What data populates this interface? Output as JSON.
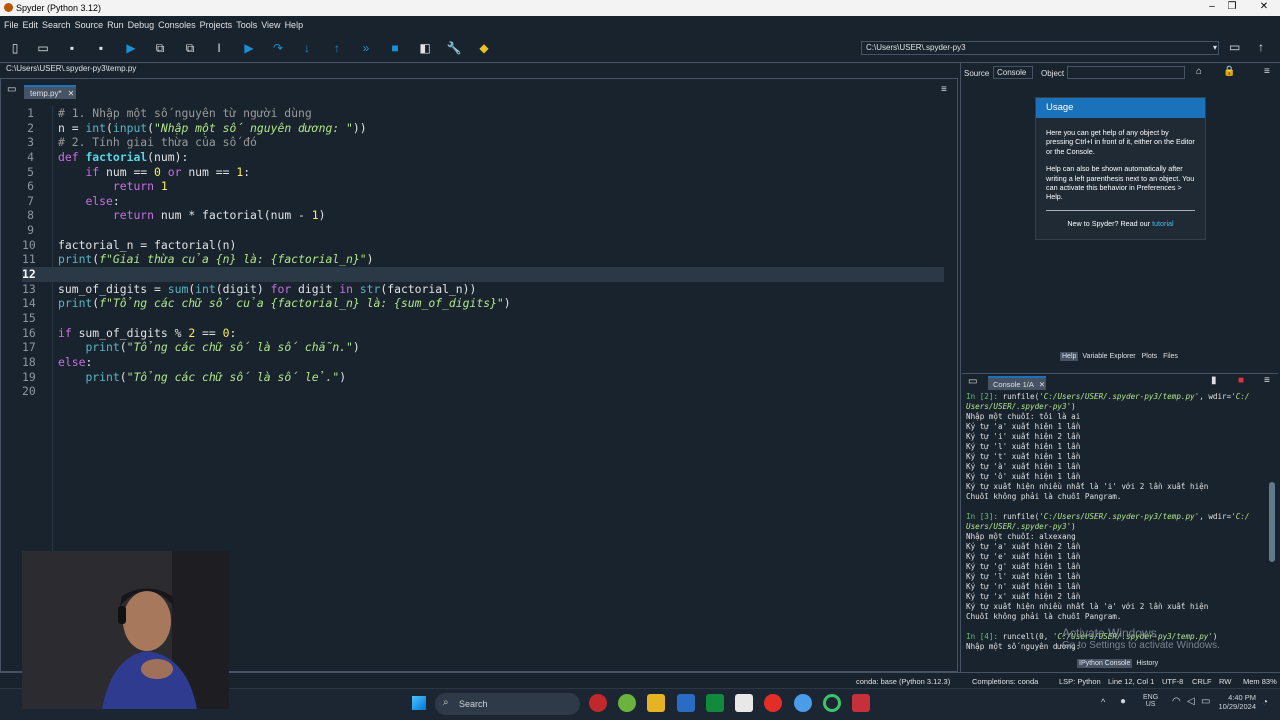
{
  "window": {
    "title": "Spyder (Python 3.12)"
  },
  "menu": [
    "File",
    "Edit",
    "Search",
    "Source",
    "Run",
    "Debug",
    "Consoles",
    "Projects",
    "Tools",
    "View",
    "Help"
  ],
  "toolbar": {
    "path": "C:\\Users\\USER\\.spyder-py3"
  },
  "editor": {
    "breadcrumb": "C:\\Users\\USER\\.spyder-py3\\temp.py",
    "tab": "temp.py*",
    "current_line": 12,
    "lines": [
      {
        "n": "1",
        "html": "<span class='cm'># 1. Nhập một số nguyên từ người dùng</span>"
      },
      {
        "n": "2",
        "html": "n = <span class='fn'>int</span>(<span class='fn'>input</span>(<span class='st'>\"Nhập một số nguyên dương: \"</span>))"
      },
      {
        "n": "3",
        "html": "<span class='cm'># 2. Tính giai thừa của số đó</span>"
      },
      {
        "n": "4",
        "html": "<span class='kw'>def</span> <span class='df'>factorial</span>(num):"
      },
      {
        "n": "5",
        "html": "    <span class='kw'>if</span> num == <span class='nm'>0</span> <span class='kw'>or</span> num == <span class='nm'>1</span>:"
      },
      {
        "n": "6",
        "html": "        <span class='kw'>return</span> <span class='nm'>1</span>"
      },
      {
        "n": "7",
        "html": "    <span class='kw'>else</span>:"
      },
      {
        "n": "8",
        "html": "        <span class='kw'>return</span> num * factorial(num - <span class='nm'>1</span>)"
      },
      {
        "n": "9",
        "html": ""
      },
      {
        "n": "10",
        "html": "factorial_n = factorial(n)"
      },
      {
        "n": "11",
        "html": "<span class='fn'>print</span>(<span class='st'>f\"Giai thừa của {n} là: {factorial_n}\"</span>)"
      },
      {
        "n": "12",
        "html": ""
      },
      {
        "n": "13",
        "html": "sum_of_digits = <span class='fn'>sum</span>(<span class='fn'>int</span>(digit) <span class='kw'>for</span> digit <span class='kw'>in</span> <span class='fn'>str</span>(factorial_n))"
      },
      {
        "n": "14",
        "html": "<span class='fn'>print</span>(<span class='st'>f\"Tổng các chữ số của {factorial_n} là: {sum_of_digits}\"</span>)"
      },
      {
        "n": "15",
        "html": ""
      },
      {
        "n": "16",
        "html": "<span class='kw'>if</span> sum_of_digits % <span class='nm'>2</span> == <span class='nm'>0</span>:"
      },
      {
        "n": "17",
        "html": "    <span class='fn'>print</span>(<span class='st'>\"Tổng các chữ số là số chẵn.\"</span>)"
      },
      {
        "n": "18",
        "html": "<span class='kw'>else</span>:"
      },
      {
        "n": "19",
        "html": "    <span class='fn'>print</span>(<span class='st'>\"Tổng các chữ số là số lẻ.\"</span>)"
      },
      {
        "n": "20",
        "html": ""
      }
    ]
  },
  "help": {
    "source_label": "Source",
    "source_value": "Console",
    "object_label": "Object",
    "usage_title": "Usage",
    "p1": "Here you can get help of any object by pressing Ctrl+I in front of it, either on the Editor or the Console.",
    "p2": "Help can also be shown automatically after writing a left parenthesis next to an object. You can activate this behavior in Preferences > Help.",
    "new_text": "New to Spyder? Read our ",
    "new_link": "tutorial",
    "tabs": [
      "Help",
      "Variable Explorer",
      "Plots",
      "Files"
    ]
  },
  "console": {
    "tab": "Console 1/A",
    "lines": [
      "<span class='pr'>In [2]:</span> runfile(<span class='cs'>'C:/Users/USER/.spyder-py3/temp.py'</span>, wdir=<span class='cs'>'C:/</span>",
      "<span class='cs'>Users/USER/.spyder-py3'</span>)",
      "Nhập một chuỗi: tôi là ai",
      "Ký tự 'a' xuất hiện 1 lần",
      "Ký tự 'i' xuất hiện 2 lần",
      "Ký tự 'l' xuất hiện 1 lần",
      "Ký tự 't' xuất hiện 1 lần",
      "Ký tự 'à' xuất hiện 1 lần",
      "Ký tự 'ô' xuất hiện 1 lần",
      "Ký tự xuất hiện nhiều nhất là 'i' với 2 lần xuất hiện",
      "Chuỗi không phải là chuỗi Pangram.",
      "",
      "<span class='pr'>In [3]:</span> runfile(<span class='cs'>'C:/Users/USER/.spyder-py3/temp.py'</span>, wdir=<span class='cs'>'C:/</span>",
      "<span class='cs'>Users/USER/.spyder-py3'</span>)",
      "Nhập một chuỗi: alxexang",
      "Ký tự 'a' xuất hiện 2 lần",
      "Ký tự 'e' xuất hiện 1 lần",
      "Ký tự 'g' xuất hiện 1 lần",
      "Ký tự 'l' xuất hiện 1 lần",
      "Ký tự 'n' xuất hiện 1 lần",
      "Ký tự 'x' xuất hiện 2 lần",
      "Ký tự xuất hiện nhiều nhất là 'a' với 2 lần xuất hiện",
      "Chuỗi không phải là chuỗi Pangram.",
      "",
      "<span class='pr'>In [4]:</span> runcell(0, <span class='cs'>'C:/Users/USER/.spyder-py3/temp.py'</span>)",
      "Nhập một số nguyên dương:"
    ],
    "bottom_tabs": [
      "IPython Console",
      "History"
    ]
  },
  "watermark": {
    "line1": "Activate Windows",
    "line2": "Go to Settings to activate Windows."
  },
  "status": {
    "env": "conda: base (Python 3.12.3)",
    "completions": "Completions: conda",
    "lsp": "LSP: Python",
    "pos": "Line 12, Col 1",
    "enc": "UTF-8",
    "eol": "CRLF",
    "rw": "RW",
    "mem": "Mem 83%"
  },
  "taskbar": {
    "search": "Search",
    "lang1": "ENG",
    "lang2": "US",
    "time": "4:40 PM",
    "date": "10/29/2024"
  },
  "colors": {
    "bg": "#19232d",
    "accent": "#1a72bb",
    "border": "#455364"
  }
}
